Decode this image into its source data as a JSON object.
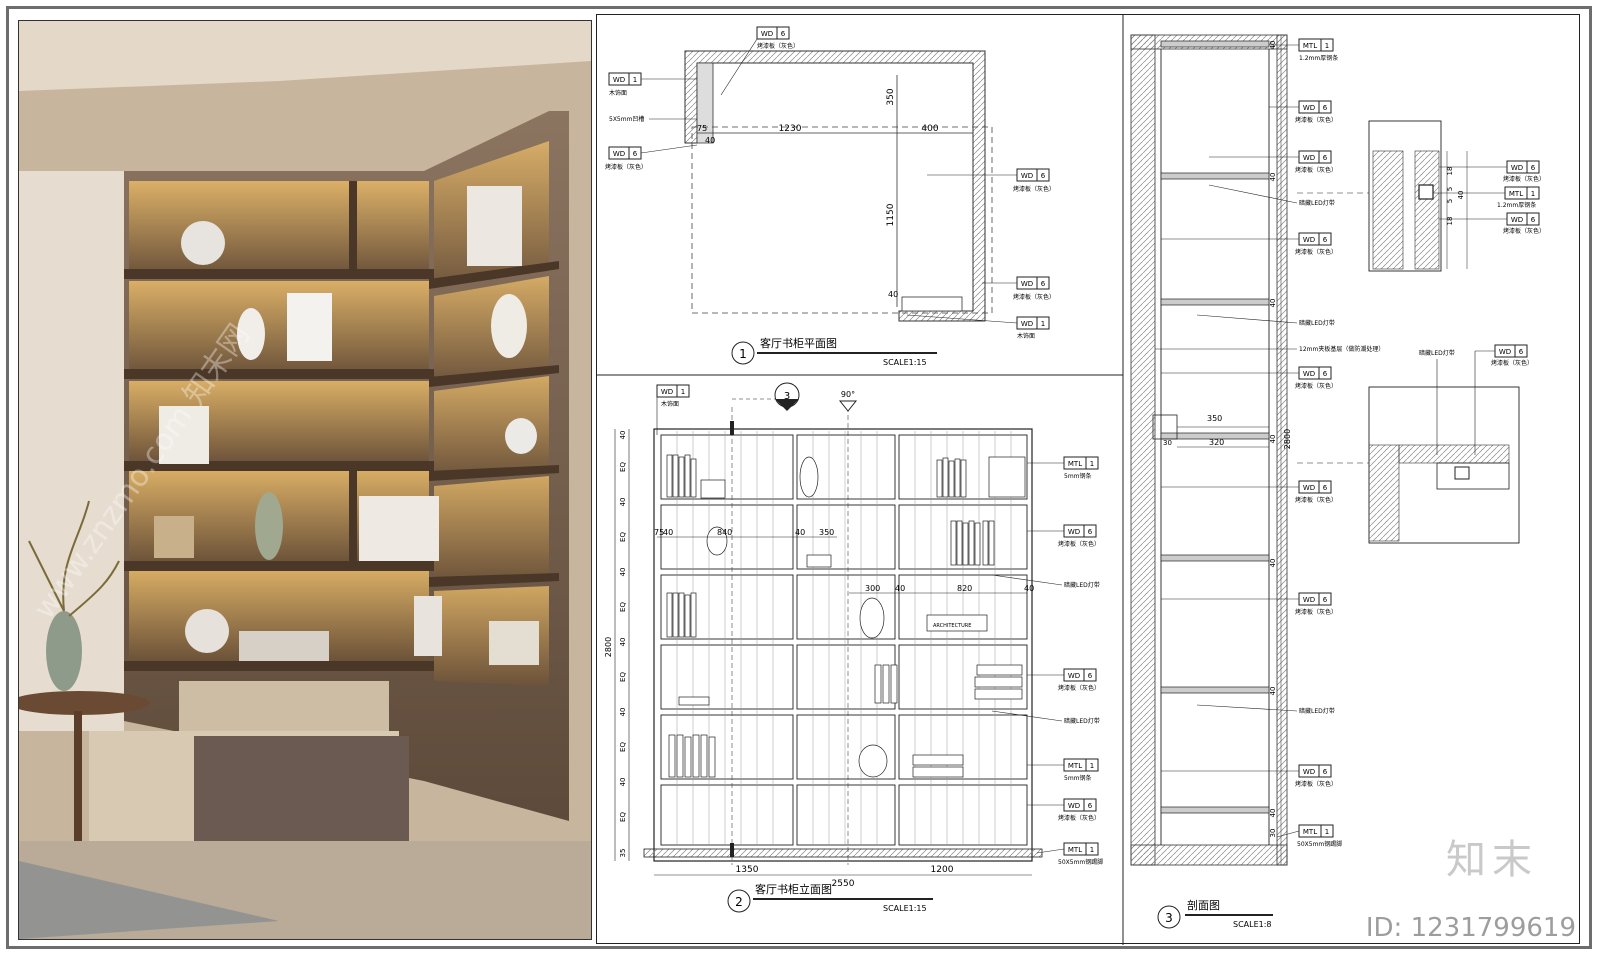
{
  "photo": {
    "watermark": "www.znzmo.com 知末网"
  },
  "plan": {
    "number": "1",
    "title": "客厅书柜平面图",
    "scale": "SCALE1:15",
    "dims": [
      "1230",
      "400",
      "350",
      "1150",
      "40",
      "75",
      "40"
    ],
    "notes": [
      "木饰面",
      "5X5mm凹槽",
      "烤漆板（灰色）",
      "烤漆板（灰色）",
      "烤漆板（灰色）",
      "烤漆板（灰色）",
      "木饰面"
    ]
  },
  "elevation": {
    "number": "2",
    "title": "客厅书柜立面图",
    "scale": "SCALE1:15",
    "dims_bottom": [
      "1350",
      "1200",
      "2550"
    ],
    "dims_left": [
      "40",
      "EQ",
      "40",
      "EQ",
      "40",
      "EQ",
      "40",
      "EQ",
      "40",
      "EQ",
      "40",
      "EQ",
      "35"
    ],
    "height": "2800",
    "inner_dims": [
      "75",
      "40",
      "840",
      "40",
      "350",
      "300",
      "40",
      "820",
      "40"
    ],
    "notes": [
      "5mm钢条",
      "烤漆板（灰色）",
      "暗藏LED灯带",
      "烤漆板（灰色）",
      "暗藏LED灯带",
      "5mm钢条",
      "烤漆板（灰色）",
      "50X5mm钢踢脚"
    ],
    "book_label": "ARCHITECTURE",
    "section_mark": "3",
    "angle": "90°"
  },
  "section": {
    "number": "3",
    "title": "剖面图",
    "scale": "SCALE1:8",
    "notes": [
      "1.2mm厚钢条",
      "烤漆板（灰色）",
      "烤漆板（灰色）",
      "暗藏LED灯带",
      "烤漆板（灰色）",
      "暗藏LED灯带",
      "12mm夹板基层（做防潮处理）",
      "烤漆板（灰色）",
      "烤漆板（灰色）",
      "烤漆板（灰色）",
      "暗藏LED灯带",
      "烤漆板（灰色）",
      "50X5mm钢踢脚"
    ],
    "dims": [
      "40",
      "40",
      "40",
      "40",
      "40",
      "40",
      "30",
      "40",
      "350",
      "320",
      "30"
    ],
    "height": "2800",
    "detail_notes": [
      "烤漆板（灰色）",
      "1.2mm厚钢条",
      "烤漆板（灰色）",
      "烤漆板（灰色）",
      "暗藏LED灯带"
    ],
    "detail_dims": [
      "18",
      "5",
      "5",
      "18",
      "40"
    ]
  },
  "tags": {
    "wd": "WD",
    "mtl": "MTL",
    "six": "6",
    "one": "1"
  },
  "branding": {
    "logo": "知末",
    "id": "ID: 1231799619"
  }
}
